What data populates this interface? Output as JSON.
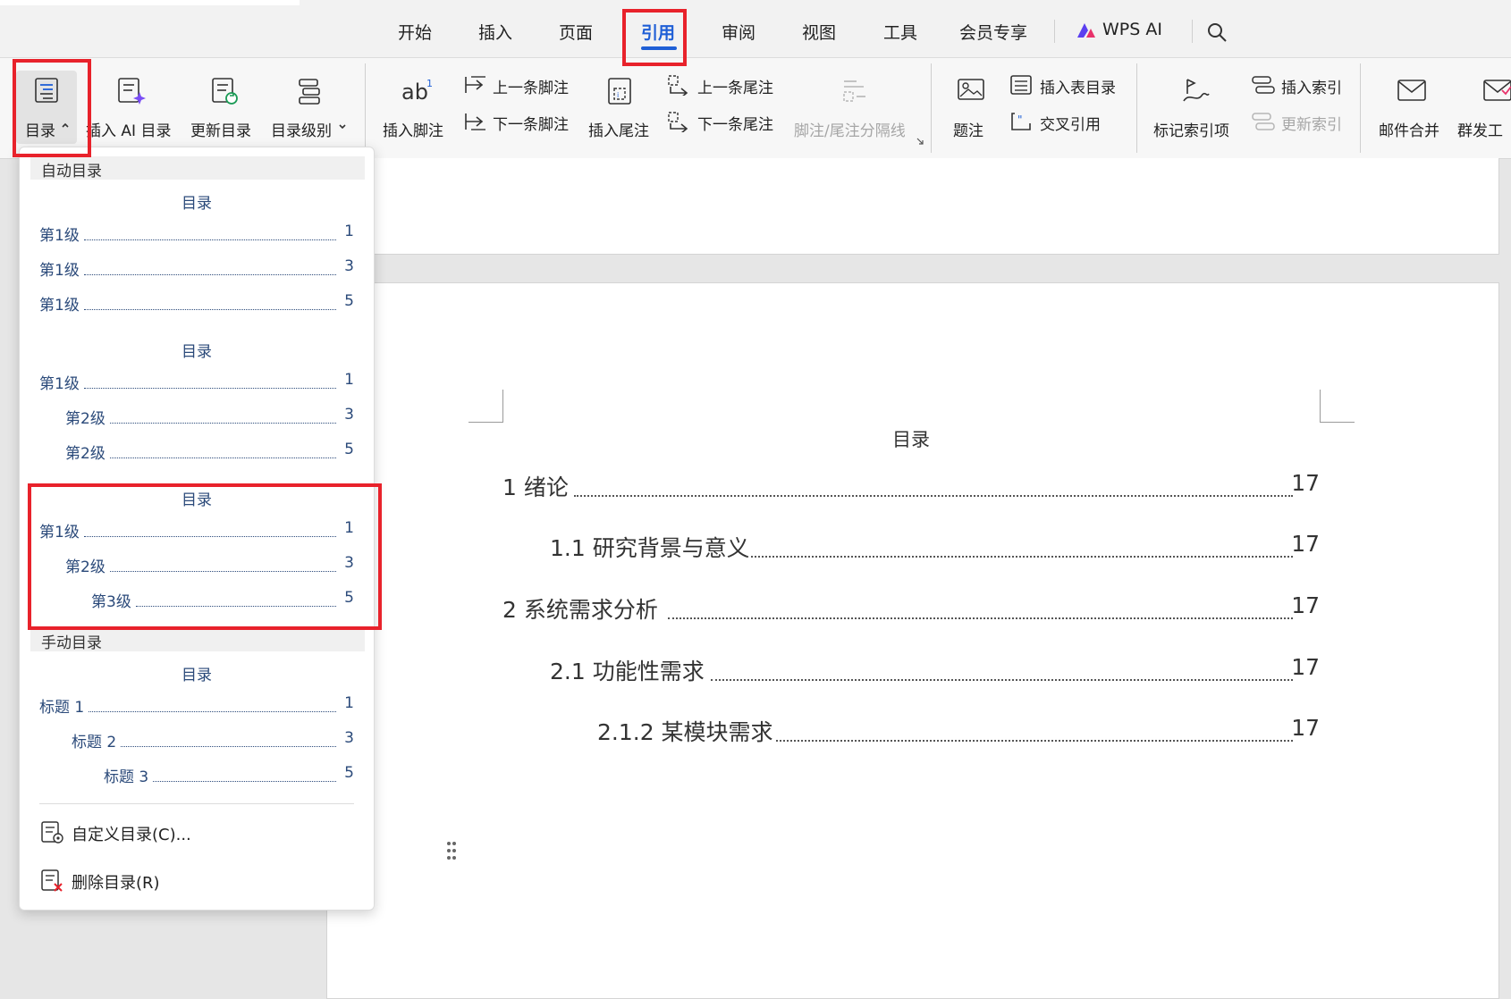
{
  "colors": {
    "accent": "#1f5fd6",
    "highlight_red": "#e8222b",
    "toc_blue": "#2b4a7a",
    "disabled": "#a6a6a6"
  },
  "menu": {
    "tabs": [
      "开始",
      "插入",
      "页面",
      "引用",
      "审阅",
      "视图",
      "工具",
      "会员专享",
      "WPS AI"
    ],
    "active_tab": "引用",
    "search_icon": "search-icon"
  },
  "ribbon": {
    "toc": "目录",
    "insert_ai_toc": "插入 AI 目录",
    "update_toc": "更新目录",
    "toc_level": "目录级别",
    "insert_footnote": "插入脚注",
    "prev_footnote": "上一条脚注",
    "next_footnote": "下一条脚注",
    "insert_endnote": "插入尾注",
    "prev_endnote": "上一条尾注",
    "next_endnote": "下一条尾注",
    "footnote_separator": "脚注/尾注分隔线",
    "caption": "题注",
    "insert_table_of_figures": "插入表目录",
    "cross_reference": "交叉引用",
    "mark_index_entry": "标记索引项",
    "insert_index": "插入索引",
    "update_index": "更新索引",
    "mail_merge": "邮件合并",
    "group_send": "群发工"
  },
  "dropdown": {
    "auto_header": "自动目录",
    "manual_header": "手动目录",
    "options": [
      {
        "title": "目录",
        "lines": [
          {
            "text": "第1级",
            "page": "1"
          },
          {
            "text": "第1级",
            "page": "3"
          },
          {
            "text": "第1级",
            "page": "5"
          }
        ]
      },
      {
        "title": "目录",
        "lines": [
          {
            "text": "第1级",
            "page": "1"
          },
          {
            "text": "第2级",
            "page": "3"
          },
          {
            "text": "第2级",
            "page": "5"
          }
        ]
      },
      {
        "title": "目录",
        "lines": [
          {
            "text": "第1级",
            "page": "1"
          },
          {
            "text": "第2级",
            "page": "3"
          },
          {
            "text": "第3级",
            "page": "5"
          }
        ]
      },
      {
        "title": "目录",
        "lines": [
          {
            "text": "标题 1",
            "page": "1"
          },
          {
            "text": "标题 2",
            "page": "3"
          },
          {
            "text": "标题 3",
            "page": "5"
          }
        ]
      }
    ],
    "custom_toc": "自定义目录(C)...",
    "delete_toc": "删除目录(R)"
  },
  "document": {
    "toc_title": "目录",
    "entries": [
      {
        "text": "1  绪论",
        "page": "17"
      },
      {
        "text": "1.1  研究背景与意义",
        "page": "17"
      },
      {
        "text": "2  系统需求分析",
        "page": "17"
      },
      {
        "text": "2.1  功能性需求",
        "page": "17"
      },
      {
        "text": "2.1.2  某模块需求",
        "page": "17"
      }
    ]
  }
}
